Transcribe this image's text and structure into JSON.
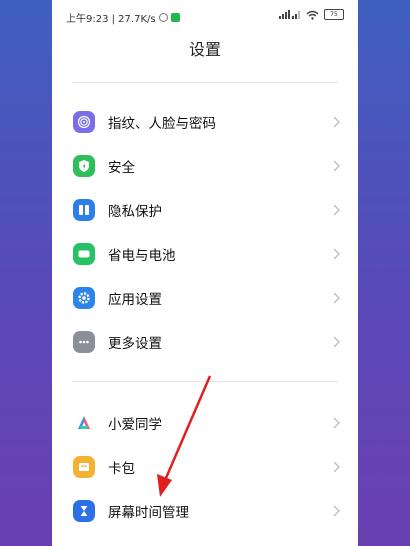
{
  "status": {
    "time_speed": "上午9:23 | 27.7K/s",
    "battery": "75"
  },
  "header": {
    "title": "设置"
  },
  "groups": [
    {
      "items": [
        {
          "label": "指纹、人脸与密码",
          "icon": "fingerprint-icon",
          "color": "#7b6ee6"
        },
        {
          "label": "安全",
          "icon": "shield-icon",
          "color": "#2fbf5a"
        },
        {
          "label": "隐私保护",
          "icon": "privacy-icon",
          "color": "#2c7fe8"
        },
        {
          "label": "省电与电池",
          "icon": "battery-icon",
          "color": "#27c266"
        },
        {
          "label": "应用设置",
          "icon": "gear-icon",
          "color": "#2c86ea"
        },
        {
          "label": "更多设置",
          "icon": "more-icon",
          "color": "#8a8f99"
        }
      ]
    },
    {
      "items": [
        {
          "label": "小爱同学",
          "icon": "xiaoai-icon",
          "color": "#ffffff"
        },
        {
          "label": "卡包",
          "icon": "wallet-icon",
          "color": "#f2b233"
        },
        {
          "label": "屏幕时间管理",
          "icon": "hourglass-icon",
          "color": "#2d6fe6"
        }
      ]
    }
  ],
  "annotation": {
    "arrow_color": "#e02020"
  }
}
